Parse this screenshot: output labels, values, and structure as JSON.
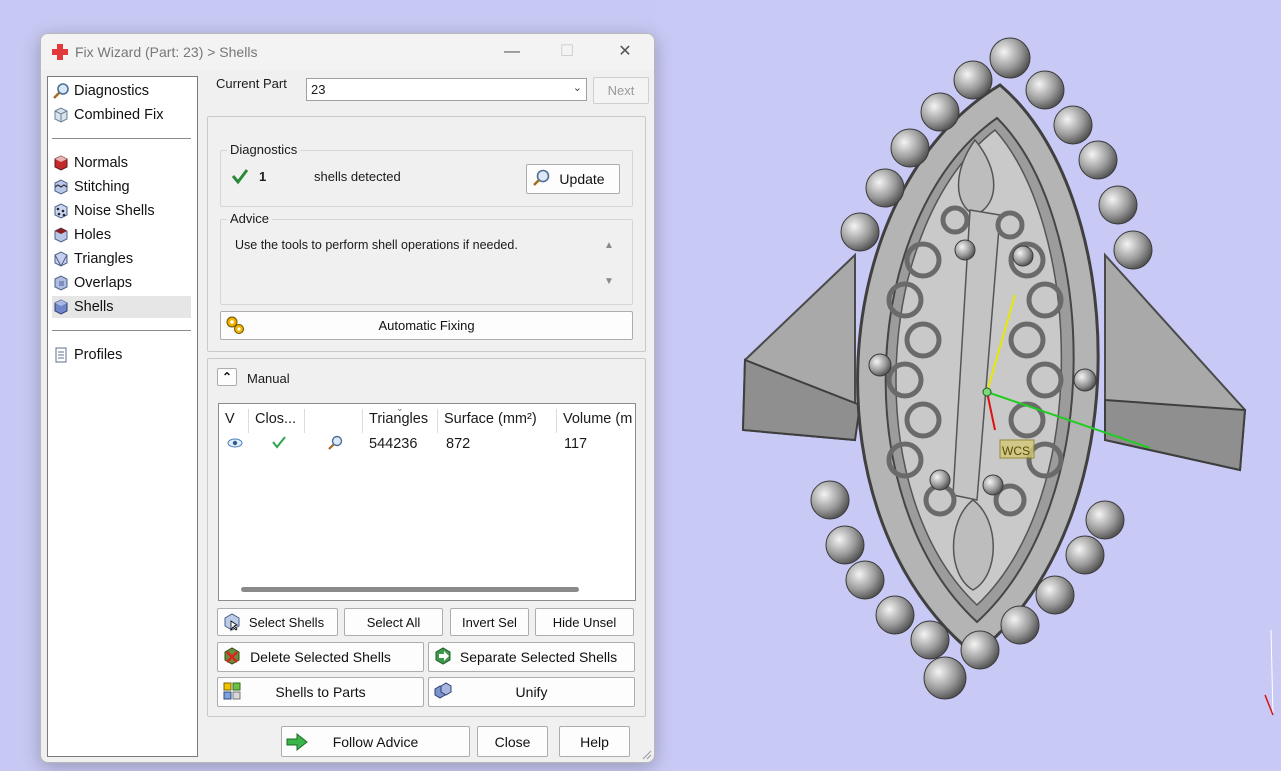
{
  "window": {
    "title": "Fix Wizard (Part: 23) > Shells",
    "minimize_glyph": "—",
    "maximize_glyph": "☐",
    "close_glyph": "✕"
  },
  "nav": {
    "top_items": [
      {
        "label": "Diagnostics",
        "icon": "magnifier-icon"
      },
      {
        "label": "Combined Fix",
        "icon": "cube-icon"
      }
    ],
    "fix_items": [
      {
        "label": "Normals",
        "icon": "normals-icon"
      },
      {
        "label": "Stitching",
        "icon": "stitching-icon"
      },
      {
        "label": "Noise Shells",
        "icon": "noise-shells-icon"
      },
      {
        "label": "Holes",
        "icon": "holes-icon"
      },
      {
        "label": "Triangles",
        "icon": "triangles-icon"
      },
      {
        "label": "Overlaps",
        "icon": "overlaps-icon"
      },
      {
        "label": "Shells",
        "icon": "shells-icon",
        "selected": true
      }
    ],
    "bottom_items": [
      {
        "label": "Profiles",
        "icon": "document-icon"
      }
    ]
  },
  "header": {
    "current_part_label": "Current Part",
    "current_part_value": "23",
    "next_label": "Next"
  },
  "diagnostics": {
    "group_title": "Diagnostics",
    "count": "1",
    "status_text": "shells detected",
    "update_label": "Update"
  },
  "advice": {
    "group_title": "Advice",
    "text": "Use the tools to perform shell operations if needed."
  },
  "automatic_fixing_label": "Automatic Fixing",
  "manual": {
    "title": "Manual",
    "columns": [
      "V",
      "Clos...",
      "",
      "Triangles",
      "Surface (mm²)",
      "Volume (m"
    ],
    "rows": [
      {
        "triangles": "544236",
        "surface": "872",
        "volume": "117"
      }
    ]
  },
  "actions": {
    "select_shells": "Select Shells",
    "select_all": "Select All",
    "invert_sel": "Invert Sel",
    "hide_unsel": "Hide Unsel",
    "delete_selected": "Delete Selected Shells",
    "separate_selected": "Separate Selected Shells",
    "shells_to_parts": "Shells to Parts",
    "unify": "Unify"
  },
  "footer": {
    "follow_advice": "Follow Advice",
    "close": "Close",
    "help": "Help"
  },
  "viewport": {
    "wcs_label": "WCS",
    "background_color": "#c8c9f5"
  }
}
